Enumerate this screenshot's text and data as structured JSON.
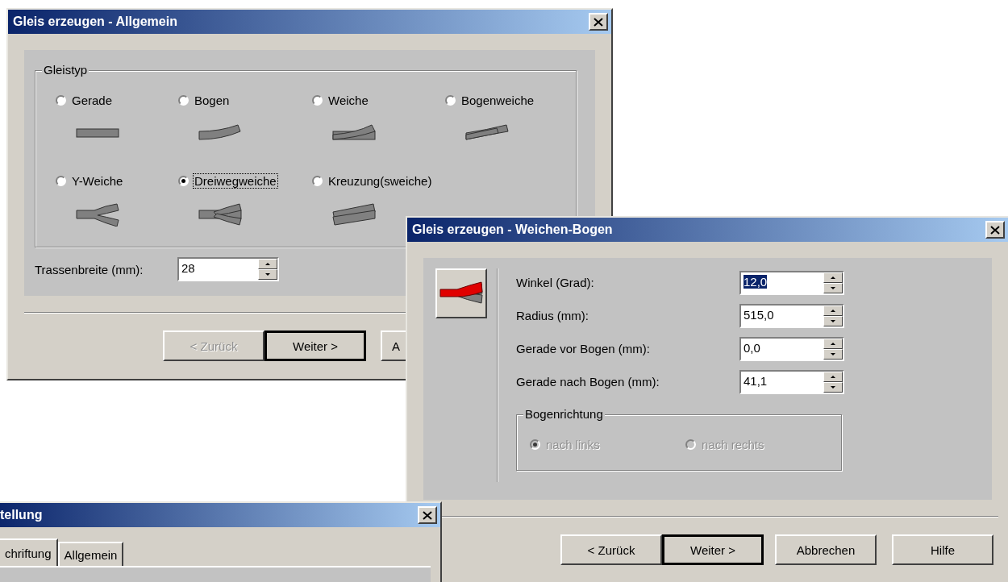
{
  "general_dialog": {
    "title": "Gleis erzeugen - Allgemein",
    "track_type": {
      "title": "Gleistyp",
      "options": [
        {
          "label": "Gerade",
          "kind": "straight",
          "selected": false
        },
        {
          "label": "Bogen",
          "kind": "curve",
          "selected": false
        },
        {
          "label": "Weiche",
          "kind": "turnout",
          "selected": false
        },
        {
          "label": "Bogenweiche",
          "kind": "curved_turnout",
          "selected": false
        },
        {
          "label": "Y-Weiche",
          "kind": "y_turnout",
          "selected": false
        },
        {
          "label": "Dreiwegweiche",
          "kind": "three_way",
          "selected": true
        },
        {
          "label": "Kreuzung(sweiche)",
          "kind": "crossing",
          "selected": false
        }
      ]
    },
    "width_field": {
      "label": "Trassenbreite (mm):",
      "value": "28"
    },
    "buttons": [
      {
        "label": "< Zurück",
        "disabled": true,
        "default": false
      },
      {
        "label": "Weiter >",
        "disabled": false,
        "default": true
      },
      {
        "label": "A",
        "disabled": false,
        "default": false
      }
    ]
  },
  "curve_dialog": {
    "title": "Gleis erzeugen - Weichen-Bogen",
    "fields": [
      {
        "label": "Winkel (Grad):",
        "value": "12,0",
        "highlighted": true
      },
      {
        "label": "Radius (mm):",
        "value": "515,0",
        "highlighted": false
      },
      {
        "label": "Gerade vor Bogen (mm):",
        "value": "0,0",
        "highlighted": false
      },
      {
        "label": "Gerade nach Bogen (mm):",
        "value": "41,1",
        "highlighted": false
      }
    ],
    "direction": {
      "title": "Bogenrichtung",
      "options": [
        {
          "label": "nach links",
          "selected": true,
          "disabled": true
        },
        {
          "label": "nach rechts",
          "selected": false,
          "disabled": true
        }
      ]
    },
    "buttons": [
      {
        "label": "< Zurück",
        "disabled": false,
        "default": false
      },
      {
        "label": "Weiter >",
        "disabled": false,
        "default": true
      },
      {
        "label": "Abbrechen",
        "disabled": false,
        "default": false
      },
      {
        "label": "Hilfe",
        "disabled": false,
        "default": false
      }
    ]
  },
  "settings_dialog": {
    "title": "tellung",
    "tabs": [
      {
        "label": "chriftung",
        "selected": true
      },
      {
        "label": "Allgemein",
        "selected": false
      }
    ]
  }
}
